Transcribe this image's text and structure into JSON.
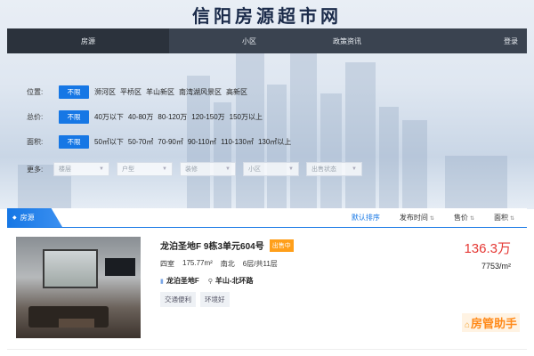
{
  "site": {
    "title": "信阳房源超市网"
  },
  "nav": {
    "items": [
      {
        "label": "房源",
        "active": true
      },
      {
        "label": "小区",
        "active": false
      },
      {
        "label": "政策资讯",
        "active": false
      }
    ],
    "login": "登录"
  },
  "filters": {
    "location": {
      "label": "位置:",
      "selected": "不限",
      "options": [
        "浉河区",
        "平桥区",
        "羊山新区",
        "南湾湖风景区",
        "高新区"
      ]
    },
    "price": {
      "label": "总价:",
      "selected": "不限",
      "options": [
        "40万以下",
        "40-80万",
        "80-120万",
        "120-150万",
        "150万以上"
      ]
    },
    "area": {
      "label": "面积:",
      "selected": "不限",
      "options": [
        "50㎡以下",
        "50-70㎡",
        "70-90㎡",
        "90-110㎡",
        "110-130㎡",
        "130㎡以上"
      ]
    },
    "more": {
      "label": "更多:",
      "dropdowns": [
        "楼层",
        "户型",
        "装修",
        "小区",
        "出售状态"
      ]
    }
  },
  "tabs": {
    "active_label": "房源"
  },
  "sort": {
    "items": [
      "默认排序",
      "发布时间",
      "售价",
      "面积"
    ]
  },
  "listing": {
    "title": "龙泊圣地F 9栋3单元604号",
    "status_badge": "出售中",
    "layout": "四室",
    "area": "175.77m²",
    "orientation": "南北",
    "floor": "6层/共11层",
    "community": "龙泊圣地F",
    "location": "羊山-北环路",
    "tags": [
      "交通便利",
      "环境好"
    ],
    "price": "136.3万",
    "unit_price": "7753/m²"
  },
  "watermark": {
    "text": "房管助手"
  },
  "colors": {
    "accent": "#1677e5",
    "price": "#e53935",
    "badge": "#ff9f1a",
    "nav_bg": "#3a4350"
  }
}
